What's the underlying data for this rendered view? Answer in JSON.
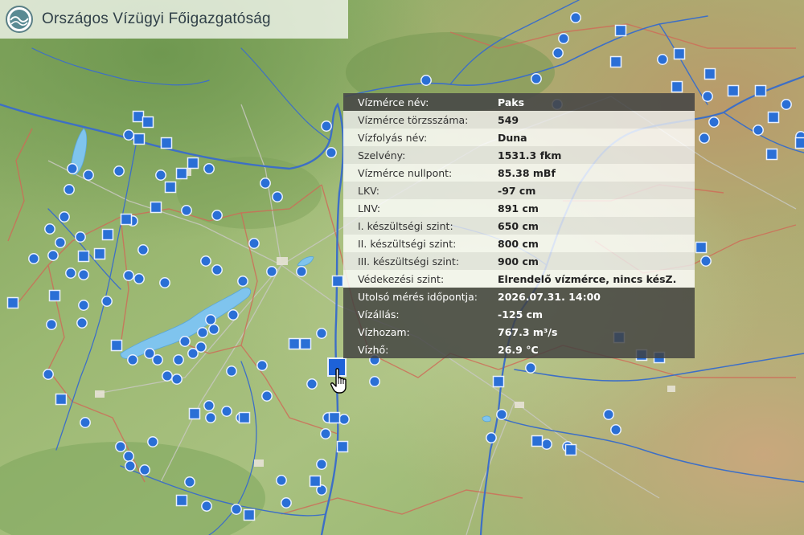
{
  "header": {
    "title": "Országos Vízügyi Főigazgatóság",
    "logo_icon": "ovf-wave-logo"
  },
  "popup": {
    "rows_light": [
      {
        "label": "Vízmérce név:",
        "value": "Paks"
      },
      {
        "label": "Vízmérce törzsszáma:",
        "value": "549"
      },
      {
        "label": "Vízfolyás név:",
        "value": "Duna"
      },
      {
        "label": "Szelvény:",
        "value": "1531.3 fkm"
      },
      {
        "label": "Vízmérce nullpont:",
        "value": "85.38 mBf"
      },
      {
        "label": "LKV:",
        "value": "-97 cm"
      },
      {
        "label": "LNV:",
        "value": "891 cm"
      },
      {
        "label": "I. készültségi szint:",
        "value": "650 cm"
      },
      {
        "label": "II. készültségi szint:",
        "value": "800 cm"
      },
      {
        "label": "III. készültségi szint:",
        "value": "900 cm"
      },
      {
        "label": "Védekezési szint:",
        "value": "Elrendelő vízmérce, nincs késZ."
      }
    ],
    "rows_dark": [
      {
        "label": "Utolsó mérés időpontja:",
        "value": "2026.07.31. 14:00"
      },
      {
        "label": "Vízállás:",
        "value": "-125 cm"
      },
      {
        "label": "Vízhozam:",
        "value": "767.3 m³/s"
      },
      {
        "label": "Vízhő:",
        "value": "26.9 °C"
      }
    ]
  },
  "colors": {
    "marker": "#2a6fd6",
    "marker_stroke": "#e8f0ff",
    "selected_marker": "#1e62d8",
    "river": "#3c6fc8",
    "border": "#d06a58",
    "lake": "#7fc6ee",
    "road": "#bdbdbd"
  }
}
